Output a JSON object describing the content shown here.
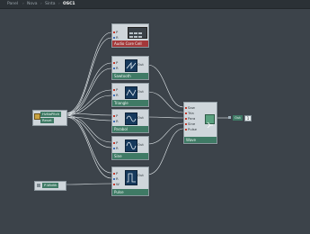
{
  "breadcrumb": {
    "items": [
      "Panel",
      "Nova",
      "Sinta",
      "OSC1"
    ],
    "separator": "›"
  },
  "nodes": {
    "audio_core": {
      "title": "Audio Core Cell",
      "pins": [
        "P",
        "R"
      ]
    },
    "sawtooth": {
      "title": "Sawtooth",
      "pins": [
        "P",
        "R"
      ],
      "out": "Out"
    },
    "triangle": {
      "title": "Triangle",
      "pins": [
        "P",
        "R"
      ],
      "out": "Out"
    },
    "parabol": {
      "title": "Parabol",
      "pins": [
        "P",
        "R"
      ],
      "out": "Out"
    },
    "sine": {
      "title": "Sine",
      "pins": [
        "P",
        "R"
      ],
      "out": "Out"
    },
    "pulse": {
      "title": "Pulse",
      "pins": [
        "P",
        "R",
        "W"
      ],
      "out": "Out"
    },
    "selector": {
      "title": "Wave",
      "pins": [
        "Saw",
        "Tria",
        "Para",
        "Sine",
        "Pulse"
      ]
    },
    "input": {
      "labels": [
        "HzNoPitch",
        "Reset"
      ]
    },
    "pwidth": {
      "label": "P-Width"
    },
    "output": {
      "label": "Out",
      "value": "1"
    }
  },
  "colors": {
    "background": "#3c434a",
    "node_body": "#cfd6db",
    "header_green": "#3f7a65",
    "header_red": "#a4383a",
    "wire": "#e6ecef",
    "wave_bg": "#16395c"
  },
  "icons": {
    "saw": "sawtooth-wave-icon",
    "tri": "triangle-wave-icon",
    "para": "parabolic-wave-icon",
    "sine": "sine-wave-icon",
    "pulse": "pulse-wave-icon",
    "switch": "switch-icon"
  }
}
